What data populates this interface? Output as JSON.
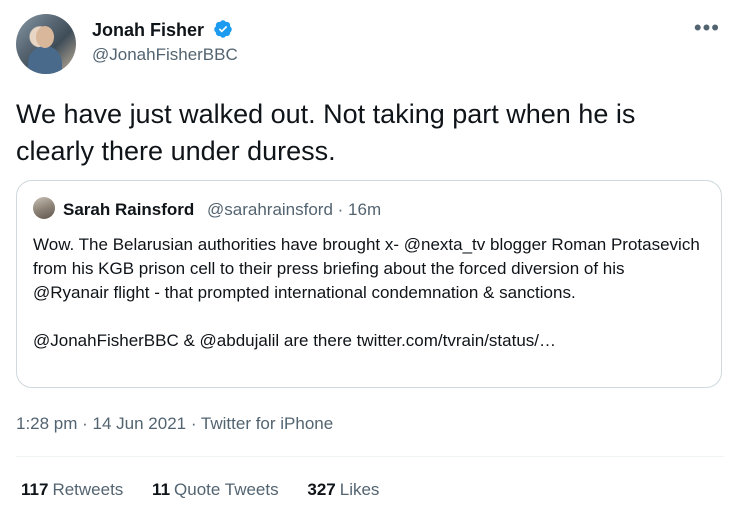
{
  "author": {
    "name": "Jonah Fisher",
    "handle": "@JonahFisherBBC"
  },
  "tweet": {
    "text": "We have just walked out.  Not taking part when he is clearly there under duress."
  },
  "quoted": {
    "name": "Sarah Rainsford",
    "meta": "@sarahrainsford · 16m",
    "text": "Wow. The Belarusian authorities have brought x- @nexta_tv blogger Roman Protasevich from his KGB prison cell to their press briefing about the forced diversion of his @Ryanair flight - that prompted international condemnation & sanctions.\n\n@JonahFisherBBC & @abdujalil are there twitter.com/tvrain/status/…"
  },
  "timestamp": "1:28 pm · 14 Jun 2021 · Twitter for iPhone",
  "stats": {
    "retweets_count": "117",
    "retweets_label": "Retweets",
    "quotes_count": "11",
    "quotes_label": "Quote Tweets",
    "likes_count": "327",
    "likes_label": "Likes"
  },
  "colors": {
    "verified": "#1d9bf0",
    "secondary_text": "#536471",
    "border": "#cfd9de"
  },
  "icons": {
    "verified": "verified-badge-icon",
    "more": "more-options-icon"
  }
}
